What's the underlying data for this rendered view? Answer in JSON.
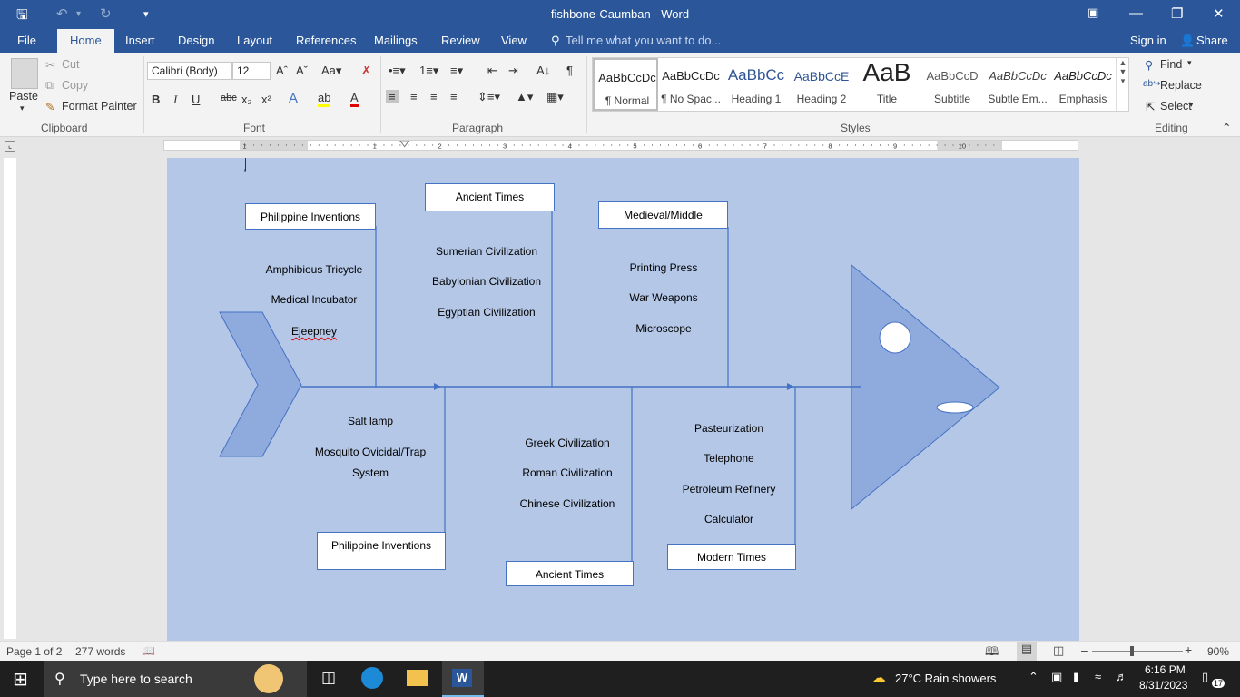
{
  "window": {
    "title": "fishbone-Caumban - Word"
  },
  "tabs": [
    "File",
    "Home",
    "Insert",
    "Design",
    "Layout",
    "References",
    "Mailings",
    "Review",
    "View"
  ],
  "tell_me": "Tell me what you want to do...",
  "account": {
    "signin": "Sign in",
    "share": "Share"
  },
  "clipboard": {
    "paste": "Paste",
    "cut": "Cut",
    "copy": "Copy",
    "format_painter": "Format Painter",
    "group": "Clipboard"
  },
  "font": {
    "name": "Calibri (Body)",
    "size": "12",
    "group": "Font"
  },
  "paragraph": {
    "group": "Paragraph"
  },
  "styles": {
    "group": "Styles",
    "items": [
      {
        "preview": "AaBbCcDc",
        "name": "¶ Normal"
      },
      {
        "preview": "AaBbCcDc",
        "name": "¶ No Spac..."
      },
      {
        "preview": "AaBbCc",
        "name": "Heading 1"
      },
      {
        "preview": "AaBbCcE",
        "name": "Heading 2"
      },
      {
        "preview": "AaB",
        "name": "Title"
      },
      {
        "preview": "AaBbCcD",
        "name": "Subtitle"
      },
      {
        "preview": "AaBbCcDc",
        "name": "Subtle Em..."
      },
      {
        "preview": "AaBbCcDc",
        "name": "Emphasis"
      }
    ]
  },
  "editing": {
    "find": "Find",
    "replace": "Replace",
    "select": "Select",
    "group": "Editing"
  },
  "ruler_numbers": [
    "1",
    "1",
    "2",
    "3",
    "4",
    "5",
    "6",
    "7",
    "8",
    "9",
    "10"
  ],
  "diagram": {
    "top_boxes": [
      "Philippine Inventions",
      "Ancient Times",
      "Medieval/Middle"
    ],
    "bottom_boxes": [
      "Philippine Inventions",
      "Ancient Times",
      "Modern Times"
    ],
    "top_lists": [
      [
        "Amphibious Tricycle",
        "Medical Incubator",
        "Ejeepney"
      ],
      [
        "Sumerian Civilization",
        "Babylonian Civilization",
        "Egyptian Civilization"
      ],
      [
        "Printing Press",
        "War Weapons",
        "Microscope"
      ]
    ],
    "bottom_lists": [
      [
        "Salt lamp",
        "Mosquito Ovicidal/Trap",
        "System"
      ],
      [
        "Greek Civilization",
        "Roman Civilization",
        "Chinese Civilization"
      ],
      [
        "Pasteurization",
        "Telephone",
        "Petroleum Refinery",
        "Calculator"
      ]
    ],
    "colors": {
      "background": "#b4c7e7",
      "shape_fill": "#8faadc",
      "line": "#4472c4"
    }
  },
  "status": {
    "page": "Page 1 of 2",
    "words": "277 words",
    "zoom": "90%"
  },
  "taskbar": {
    "search_placeholder": "Type here to search",
    "weather": "27°C  Rain showers",
    "time": "6:16 PM",
    "date": "8/31/2023",
    "notifications": "17"
  }
}
